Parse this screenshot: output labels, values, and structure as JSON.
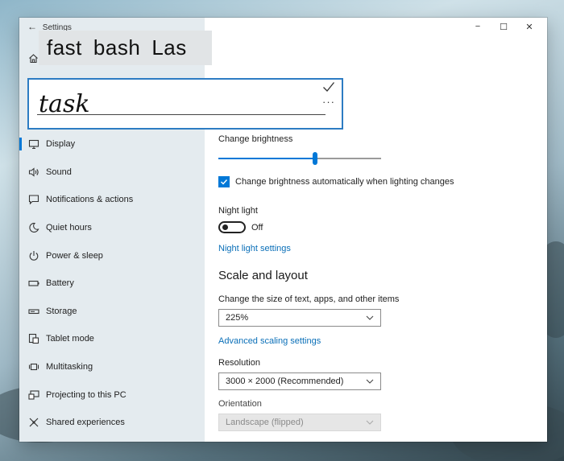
{
  "window": {
    "title": "Settings",
    "back_glyph": "←",
    "minimize_glyph": "−",
    "maximize_glyph": "☐",
    "close_glyph": "✕"
  },
  "sidebar": {
    "home_icon": "home-icon",
    "items": [
      {
        "label": "Display",
        "icon": "display-icon",
        "selected": true
      },
      {
        "label": "Sound",
        "icon": "sound-icon"
      },
      {
        "label": "Notifications & actions",
        "icon": "notifications-icon"
      },
      {
        "label": "Quiet hours",
        "icon": "moon-icon"
      },
      {
        "label": "Power & sleep",
        "icon": "power-icon"
      },
      {
        "label": "Battery",
        "icon": "battery-icon"
      },
      {
        "label": "Storage",
        "icon": "storage-icon"
      },
      {
        "label": "Tablet mode",
        "icon": "tablet-icon"
      },
      {
        "label": "Multitasking",
        "icon": "multitasking-icon"
      },
      {
        "label": "Projecting to this PC",
        "icon": "projecting-icon"
      },
      {
        "label": "Shared experiences",
        "icon": "shared-icon"
      }
    ]
  },
  "main": {
    "brightness_label": "Change brightness",
    "brightness_level_pct": 59,
    "auto_brightness_label": "Change brightness automatically when lighting changes",
    "auto_brightness_checked": true,
    "night_light_label": "Night light",
    "night_light_state": "Off",
    "night_light_settings_link": "Night light settings",
    "scale_section_title": "Scale and layout",
    "scale_label": "Change the size of text, apps, and other items",
    "scale_value": "225%",
    "advanced_scaling_link": "Advanced scaling settings",
    "resolution_label": "Resolution",
    "resolution_value": "3000 × 2000 (Recommended)",
    "orientation_label": "Orientation",
    "orientation_value": "Landscape (flipped)"
  },
  "handwriting": {
    "suggestions": [
      "fast",
      "bash",
      "Las"
    ],
    "ink_text": "task",
    "more_glyph": "···"
  },
  "colors": {
    "accent": "#0078d7",
    "link": "#0a6fb8",
    "ink_panel_border": "#2d7cc3"
  }
}
